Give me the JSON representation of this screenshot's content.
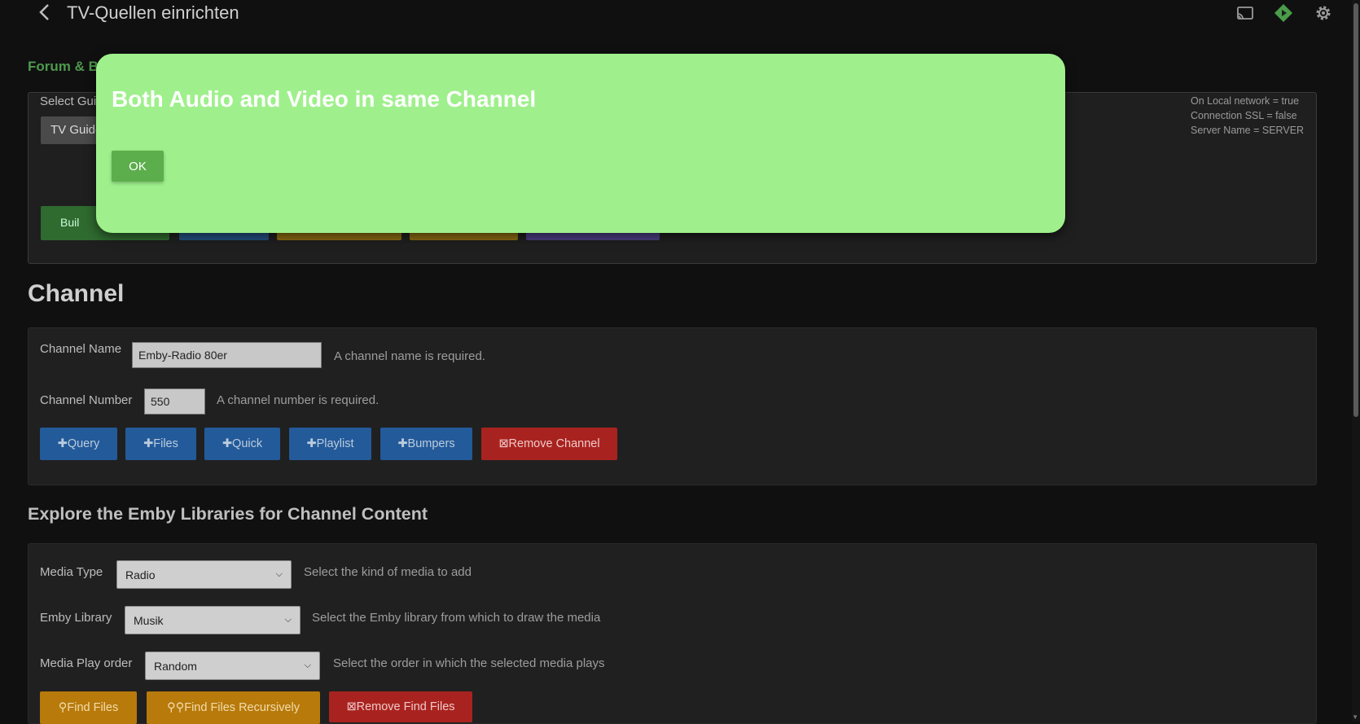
{
  "header": {
    "title": "TV-Quellen einrichten"
  },
  "guide_section": {
    "forum_title": "Forum & B",
    "select_label": "Select Gui",
    "select_value": "TV Guide",
    "build_button": "Buil",
    "network_info": [
      "On Local network = true",
      "Connection SSL = false",
      "Server Name = SERVER"
    ]
  },
  "channel": {
    "heading": "Channel",
    "name_label": "Channel Name",
    "name_value": "Emby-Radio 80er",
    "name_hint": "A channel name is required.",
    "number_label": "Channel Number",
    "number_value": "550",
    "number_hint": "A channel number is required.",
    "buttons": {
      "query": "✚Query",
      "files": "✚Files",
      "quick": "✚Quick",
      "playlist": "✚Playlist",
      "bumpers": "✚Bumpers",
      "remove_channel": "⊠Remove Channel"
    }
  },
  "explore": {
    "heading": "Explore the Emby Libraries for Channel Content",
    "media_type_label": "Media Type",
    "media_type_value": "Radio",
    "media_type_hint": "Select the kind of media to add",
    "library_label": "Emby Library",
    "library_value": "Musik",
    "library_hint": "Select the Emby library from which to draw the media",
    "order_label": "Media Play order",
    "order_value": "Random",
    "order_hint": "Select the order in which the selected media plays",
    "buttons": {
      "find_files": "⚲Find Files",
      "find_recursive": "⚲⚲Find Files Recursively",
      "remove_find": "⊠Remove Find Files"
    }
  },
  "dialog": {
    "title": "Both Audio and Video in same Channel",
    "ok_label": "OK"
  },
  "colors": {
    "dialog_bg": "#9ff08c",
    "ok_button": "#5cae4c",
    "blue_button": "#235a9a",
    "red_button": "#a8231f",
    "amber_button": "#b77a0b"
  },
  "icons": [
    "back-arrow-icon",
    "cast-icon",
    "play-icon",
    "gear-icon",
    "chevron-down-icon"
  ]
}
